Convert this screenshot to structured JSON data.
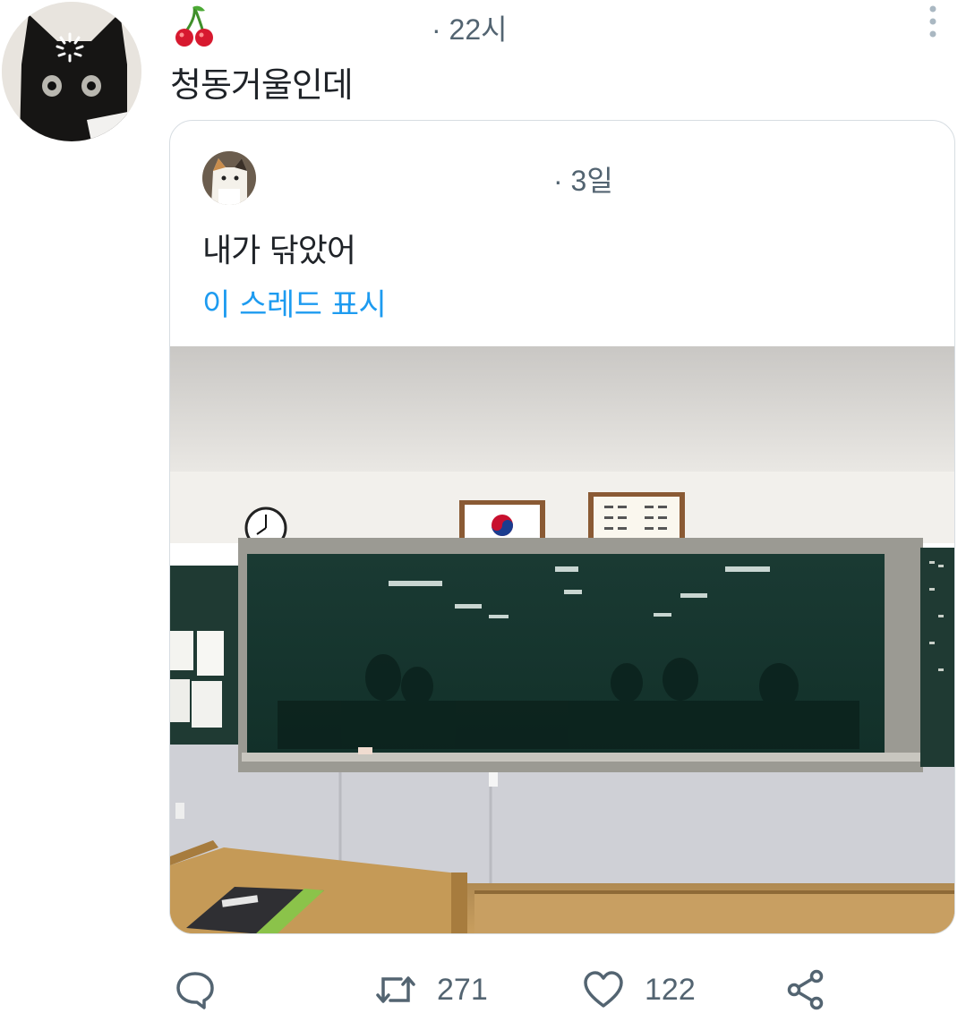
{
  "tweet": {
    "time": "· 22시",
    "text": "청동거울인데"
  },
  "quoted_tweet": {
    "time": "· 3일",
    "text": "내가 닦았어",
    "thread_link": "이 스레드 표시",
    "accent_color": "#1d9bf0"
  },
  "actions": {
    "reply_icon": "speech-bubble-icon",
    "retweet_icon": "retweet-arrows-icon",
    "retweet_count": "271",
    "like_icon": "heart-icon",
    "like_count": "122",
    "share_icon": "share-icon"
  }
}
